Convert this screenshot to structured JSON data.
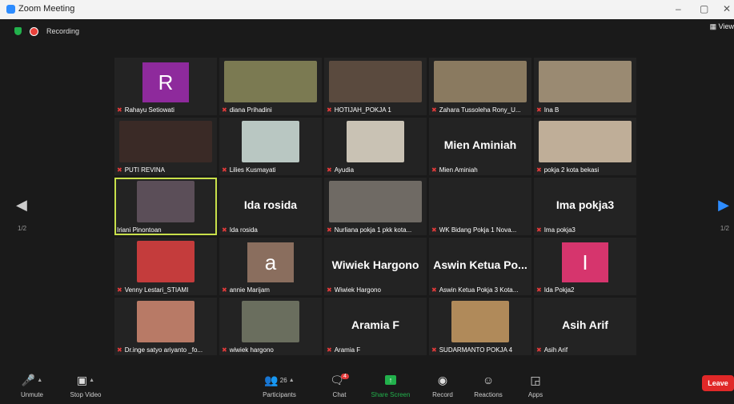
{
  "window": {
    "title": "Zoom Meeting",
    "minimize": "–",
    "maximize": "▢",
    "close": "✕"
  },
  "status": {
    "recording_label": "Recording",
    "view_label": "View"
  },
  "pager": {
    "left": "1/2",
    "right": "1/2"
  },
  "tiles": [
    {
      "label": "Rahayu Setiowati",
      "type": "avatar",
      "avatar": "R",
      "color": "#8e2a9c"
    },
    {
      "label": "diana Prihadini",
      "type": "video",
      "color": "#7b7a52"
    },
    {
      "label": "HOTIJAH_POKJA 1",
      "type": "video",
      "color": "#5a4a3e"
    },
    {
      "label": "Zahara Tussoleha Rony_U...",
      "type": "video",
      "color": "#8a7a60"
    },
    {
      "label": "Ina B",
      "type": "video",
      "color": "#9a8a72"
    },
    {
      "label": "PUTI REVINA",
      "type": "video",
      "color": "#3a2a26"
    },
    {
      "label": "Lilies Kusmayati",
      "type": "video-small",
      "color": "#b9c7c2"
    },
    {
      "label": "Ayudia",
      "type": "video-small",
      "color": "#c9c2b4"
    },
    {
      "label": "Mien Aminiah",
      "type": "text",
      "text": "Mien Aminiah"
    },
    {
      "label": "pokja 2 kota bekasi",
      "type": "video",
      "color": "#bfae98"
    },
    {
      "label": "Iriani Pinontoan",
      "type": "video-small",
      "color": "#5b4e58",
      "active": true
    },
    {
      "label": "Ida rosida",
      "type": "text",
      "text": "Ida rosida"
    },
    {
      "label": "Nurliana pokja 1 pkk kota...",
      "type": "video",
      "color": "#6f6a64"
    },
    {
      "label": "WK Bidang Pokja 1 Nova...",
      "type": "text",
      "text": ""
    },
    {
      "label": "Ima pokja3",
      "type": "text",
      "text": "Ima pokja3"
    },
    {
      "label": "Venny Lestari_STIAMI",
      "type": "video-small",
      "color": "#c43c3c"
    },
    {
      "label": "annie Marijam",
      "type": "avatar",
      "avatar": "a",
      "color": "#8a6e5e"
    },
    {
      "label": "Wiwiek Hargono",
      "type": "text",
      "text": "Wiwiek Hargono"
    },
    {
      "label": "Aswin Ketua Pokja 3 Kota...",
      "type": "text",
      "text": "Aswin Ketua Po..."
    },
    {
      "label": "Ida Pokja2",
      "type": "avatar",
      "avatar": "I",
      "color": "#d6356d"
    },
    {
      "label": "Dr.inge satyo ariyanto _fo...",
      "type": "video-small",
      "color": "#b87a66"
    },
    {
      "label": "wiwiek hargono",
      "type": "video-small",
      "color": "#6a6e5e"
    },
    {
      "label": "Aramia F",
      "type": "text",
      "text": "Aramia F"
    },
    {
      "label": "SUDARMANTO POKJA 4",
      "type": "video-small",
      "color": "#b08a5a"
    },
    {
      "label": "Asih Arif",
      "type": "text",
      "text": "Asih Arif"
    }
  ],
  "toolbar": {
    "unmute": "Unmute",
    "stop_video": "Stop Video",
    "participants": "Participants",
    "participants_count": "26",
    "chat": "Chat",
    "chat_badge": "4",
    "share_screen": "Share Screen",
    "record": "Record",
    "reactions": "Reactions",
    "apps": "Apps",
    "leave": "Leave"
  },
  "colors": {
    "accent": "#2d8cff",
    "share_green": "#22b14c",
    "leave_red": "#e02828",
    "active_border": "#c8e04a"
  }
}
